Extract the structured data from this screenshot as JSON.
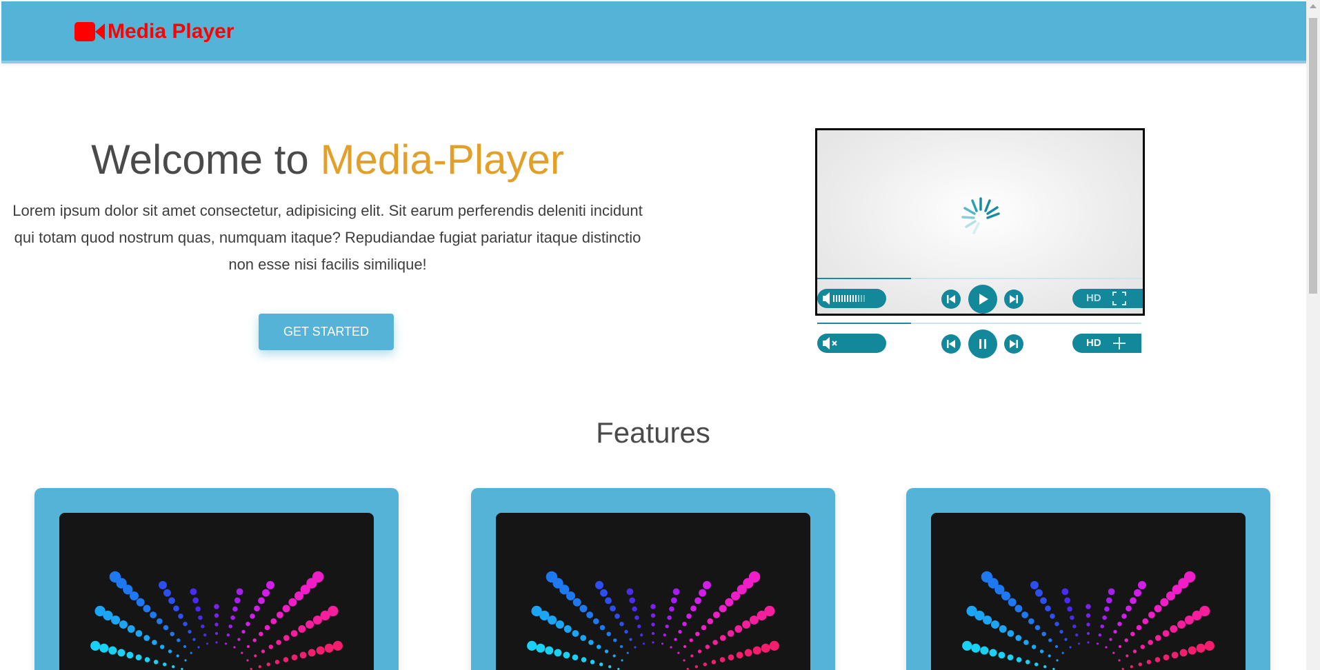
{
  "header": {
    "brand_text": "Media Player",
    "brand_icon": "video-camera-icon",
    "brand_color": "#ff0000",
    "bar_color": "#54b3d6"
  },
  "hero": {
    "title_prefix": "Welcome to",
    "title_accent": "Media-Player",
    "accent_color": "#e3a028",
    "description": "Lorem ipsum dolor sit amet consectetur, adipisicing elit. Sit earum perferendis deleniti incidunt qui totam quod nostrum quas, numquam itaque? Repudiandae fugiat pariatur itaque distinctio non esse nisi facilis similique!",
    "cta_label": "GET STARTED"
  },
  "player": {
    "hd_label": "HD",
    "playing_controls": [
      "volume-icon",
      "previous-icon",
      "play-icon",
      "next-icon",
      "fullscreen-icon"
    ],
    "paused_controls": [
      "mute-icon",
      "previous-icon",
      "pause-icon",
      "next-icon",
      "fullscreen-icon"
    ],
    "progress": 0.28
  },
  "features": {
    "title": "Features",
    "cards": [
      {
        "image": "music-visualizer-image"
      },
      {
        "image": "music-visualizer-image"
      },
      {
        "image": "music-visualizer-image"
      }
    ]
  }
}
